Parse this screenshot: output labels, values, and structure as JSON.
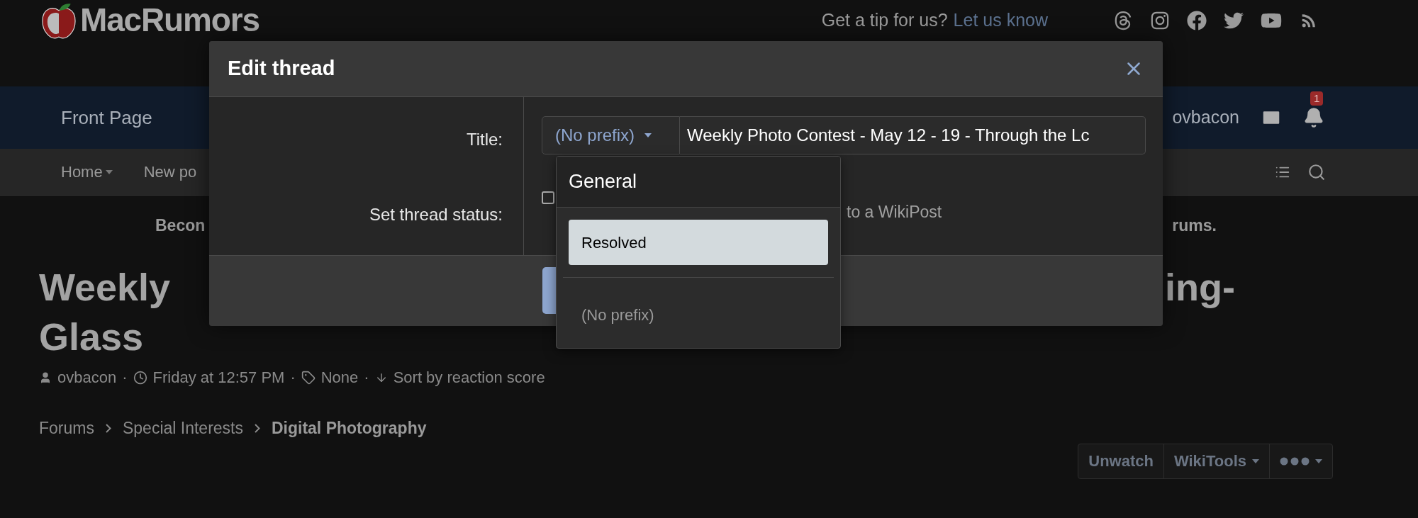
{
  "header": {
    "logo_text": "MacRumors",
    "tip_prompt": "Get a tip for us?",
    "tip_link": "Let us know"
  },
  "nav": {
    "items": [
      {
        "label": "Front Page"
      }
    ],
    "username": "ovbacon",
    "notification_badge": "1"
  },
  "subnav": {
    "items": [
      {
        "label": "Home",
        "has_menu": true
      },
      {
        "label": "New po",
        "has_menu": false
      }
    ]
  },
  "banner": {
    "left": "Becon",
    "right": "rums."
  },
  "thread": {
    "title_line1_left": "Weekly",
    "title_line1_right": "ing-",
    "title_line2": "Glass",
    "meta": [
      {
        "kind": "author",
        "text": "ovbacon"
      },
      {
        "kind": "separator",
        "text": "·"
      },
      {
        "kind": "date",
        "text": "Friday at 12:57 PM"
      },
      {
        "kind": "separator",
        "text": "·"
      },
      {
        "kind": "tags",
        "text": "None"
      },
      {
        "kind": "separator",
        "text": "·"
      },
      {
        "kind": "sort",
        "text": "Sort by reaction score"
      }
    ]
  },
  "breadcrumbs": [
    {
      "label": "Forums",
      "current": false
    },
    {
      "label": "Special Interests",
      "current": false
    },
    {
      "label": "Digital Photography",
      "current": true
    }
  ],
  "thread_actions": [
    {
      "kind": "text",
      "label": "Unwatch"
    },
    {
      "kind": "menu",
      "label": "WikiTools"
    },
    {
      "kind": "more"
    }
  ],
  "modal": {
    "title": "Edit thread",
    "title_label": "Title:",
    "prefix": "(No prefix)",
    "title_value": "Weekly Photo Contest - May 12 - 19 - Through the Lc",
    "status_label": "Set thread status:",
    "status_checked": false,
    "status_option_fragment": "to a WikiPost"
  },
  "prefix_menu": {
    "group": "General",
    "options": [
      {
        "label": "Resolved",
        "selected": true
      },
      {
        "label": "(No prefix)",
        "selected": false
      }
    ]
  }
}
